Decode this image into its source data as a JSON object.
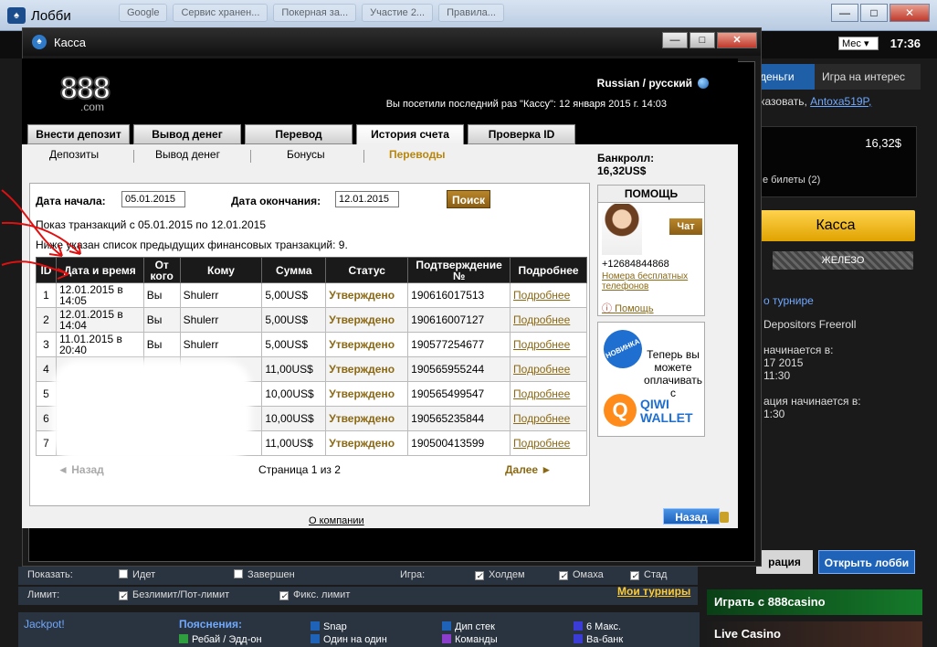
{
  "lobby": {
    "title": "Лобби",
    "taskbar_tabs": [
      "Google",
      "Сервис хранен...",
      "Покерная за...",
      "Участие 2...",
      "Правила..."
    ],
    "clock": "17:36",
    "period_select": "Мес",
    "tab_money": "деньги",
    "tab_play": "Игра на интерес",
    "welcome_prefix": "казовать,",
    "welcome_user": "Antoxa519P,",
    "balance": "16,32$",
    "tickets": "е билеты (2)",
    "cashier_button": "Касса",
    "iron_label": "ЖЕЛЕЗО",
    "tourney_info": "о турнире",
    "tourney_name": "Depositors Freeroll",
    "starts_label": "начинается в:",
    "starts_date": "17 2015",
    "starts_time": "11:30",
    "reg_label": "ация начинается в:",
    "reg_time": "1:30",
    "reg_button": "рация",
    "open_lobby": "Открыть лобби",
    "casino_banner": "Играть с 888casino",
    "live_banner": "Live Casino"
  },
  "filters": {
    "show_label": "Показать:",
    "going": "Идет",
    "finished": "Завершен",
    "game_label": "Игра:",
    "holdem": "Холдем",
    "omaha": "Омаха",
    "stud": "Стад",
    "limit_label": "Лимит:",
    "nolimit": "Безлимит/Пот-лимит",
    "fixed": "Фикс. лимит",
    "my_tournaments": "Мои турниры"
  },
  "legend": {
    "jackpot": "Jackpot!",
    "title": "Пояснения:",
    "rebuy": "Ребай / Эдд-он",
    "snap": "Snap",
    "one_on_one": "Один на один",
    "deep": "Дип стек",
    "teams": "Команды",
    "six_max": "6 Макс.",
    "vabank": "Ва-банк"
  },
  "cashier": {
    "window_title": "Касса",
    "logo": "888",
    "logo_sub": ".com",
    "language": "Russian / русский",
    "last_visit": "Вы посетили последний раз \"Кассу\": 12 января 2015 г. 14:03",
    "tabs": [
      "Внести депозит",
      "Вывод денег",
      "Перевод",
      "История счета",
      "Проверка ID"
    ],
    "subtabs": [
      "Депозиты",
      "Вывод денег",
      "Бонусы",
      "Переводы"
    ],
    "bankroll_label": "Банкролл:",
    "bankroll_value": "16,32US$",
    "start_label": "Дата начала:",
    "start_value": "05.01.2015",
    "end_label": "Дата окончания:",
    "end_value": "12.01.2015",
    "search": "Поиск",
    "shown_line": "Показ транзакций с 05.01.2015 по 12.01.2015",
    "count_line": "Ниже указан список предыдущих финансовых транзакций: 9.",
    "columns": [
      "ID",
      "Дата и время",
      "От кого",
      "Кому",
      "Сумма",
      "Статус",
      "Подтверждение №",
      "Подробнее"
    ],
    "rows": [
      [
        "1",
        "12.01.2015 в 14:05",
        "Вы",
        "Shulerr",
        "5,00US$",
        "Утверждено",
        "190616017513",
        "Подробнее"
      ],
      [
        "2",
        "12.01.2015 в 14:04",
        "Вы",
        "Shulerr",
        "5,00US$",
        "Утверждено",
        "190616007127",
        "Подробнее"
      ],
      [
        "3",
        "11.01.2015 в 20:40",
        "Вы",
        "Shulerr",
        "5,00US$",
        "Утверждено",
        "190577254677",
        "Подробнее"
      ],
      [
        "4",
        "",
        "",
        "",
        "11,00US$",
        "Утверждено",
        "190565955244",
        "Подробнее"
      ],
      [
        "5",
        "",
        "",
        "",
        "10,00US$",
        "Утверждено",
        "190565499547",
        "Подробнее"
      ],
      [
        "6",
        "",
        "",
        "",
        "10,00US$",
        "Утверждено",
        "190565235844",
        "Подробнее"
      ],
      [
        "7",
        "",
        "",
        "",
        "11,00US$",
        "Утверждено",
        "190500413599",
        "Подробнее"
      ]
    ],
    "prev": "◄ Назад",
    "page_info": "Страница 1 из 2",
    "next": "Далее ►",
    "about": "О компании",
    "back_button": "Назад",
    "help_title": "ПОМОЩЬ",
    "chat": "Чат",
    "phone": "+12684844868",
    "free_numbers": "Номера бесплатных телефонов",
    "help_link": "Помощь",
    "qiwi_badge": "НОВИНКА",
    "qiwi_text": "Теперь вы можете оплачивать с",
    "qiwi_word1": "QIWI",
    "qiwi_word2": "WALLET"
  },
  "colors": {
    "accent_gold": "#8b6914",
    "status_color": "#8b6914",
    "lobby_blue": "#1e63b8",
    "kassa_yellow": "#ffd34d"
  }
}
